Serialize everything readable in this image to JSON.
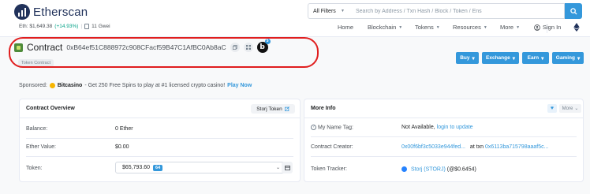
{
  "header": {
    "brand": "Etherscan",
    "eth_price_label": "Eth: $1,649.38",
    "eth_price_change": "(+14.93%)",
    "separator": "|",
    "gas": "11 Gwei",
    "search": {
      "filter": "All Filters",
      "placeholder": "Search by Address / Txn Hash / Block / Token / Ens"
    },
    "nav": {
      "home": "Home",
      "blockchain": "Blockchain",
      "tokens": "Tokens",
      "resources": "Resources",
      "more": "More",
      "signin": "Sign In"
    }
  },
  "contract": {
    "title": "Contract",
    "address": "0xB64ef51C888972c908CFacf59B47C1AfBC0Ab8aC",
    "badge_count": "5",
    "tag": "Token Contract"
  },
  "actions": {
    "buy": "Buy",
    "exchange": "Exchange",
    "earn": "Earn",
    "gaming": "Gaming"
  },
  "sponsor": {
    "label": "Sponsored:",
    "name": "Bitcasino",
    "text": "- Get 250 Free Spins to play at #1 licensed crypto casino!",
    "cta": "Play Now"
  },
  "overview": {
    "title": "Contract Overview",
    "token_button": "Storj Token",
    "balance_label": "Balance:",
    "balance_value": "0 Ether",
    "ether_value_label": "Ether Value:",
    "ether_value": "$0.00",
    "token_label": "Token:",
    "token_value": "$65,793.60",
    "token_count": "64"
  },
  "more_info": {
    "title": "More Info",
    "more_button": "More",
    "name_tag_label": "My Name Tag:",
    "name_tag_value": "Not Available,",
    "name_tag_link": "login to update",
    "creator_label": "Contract Creator:",
    "creator_address": "0x00f6bf3c5033e944fed...",
    "creator_at": "at txn",
    "creator_txn": "0x6113ba715798aaaf5c...",
    "tracker_label": "Token Tracker:",
    "tracker_name": "Storj (STORJ)",
    "tracker_price": "(@$0.6454)"
  },
  "colors": {
    "brand": "#21325b",
    "accent": "#3498db",
    "positive": "#00a186",
    "highlight": "#e01e1e"
  }
}
